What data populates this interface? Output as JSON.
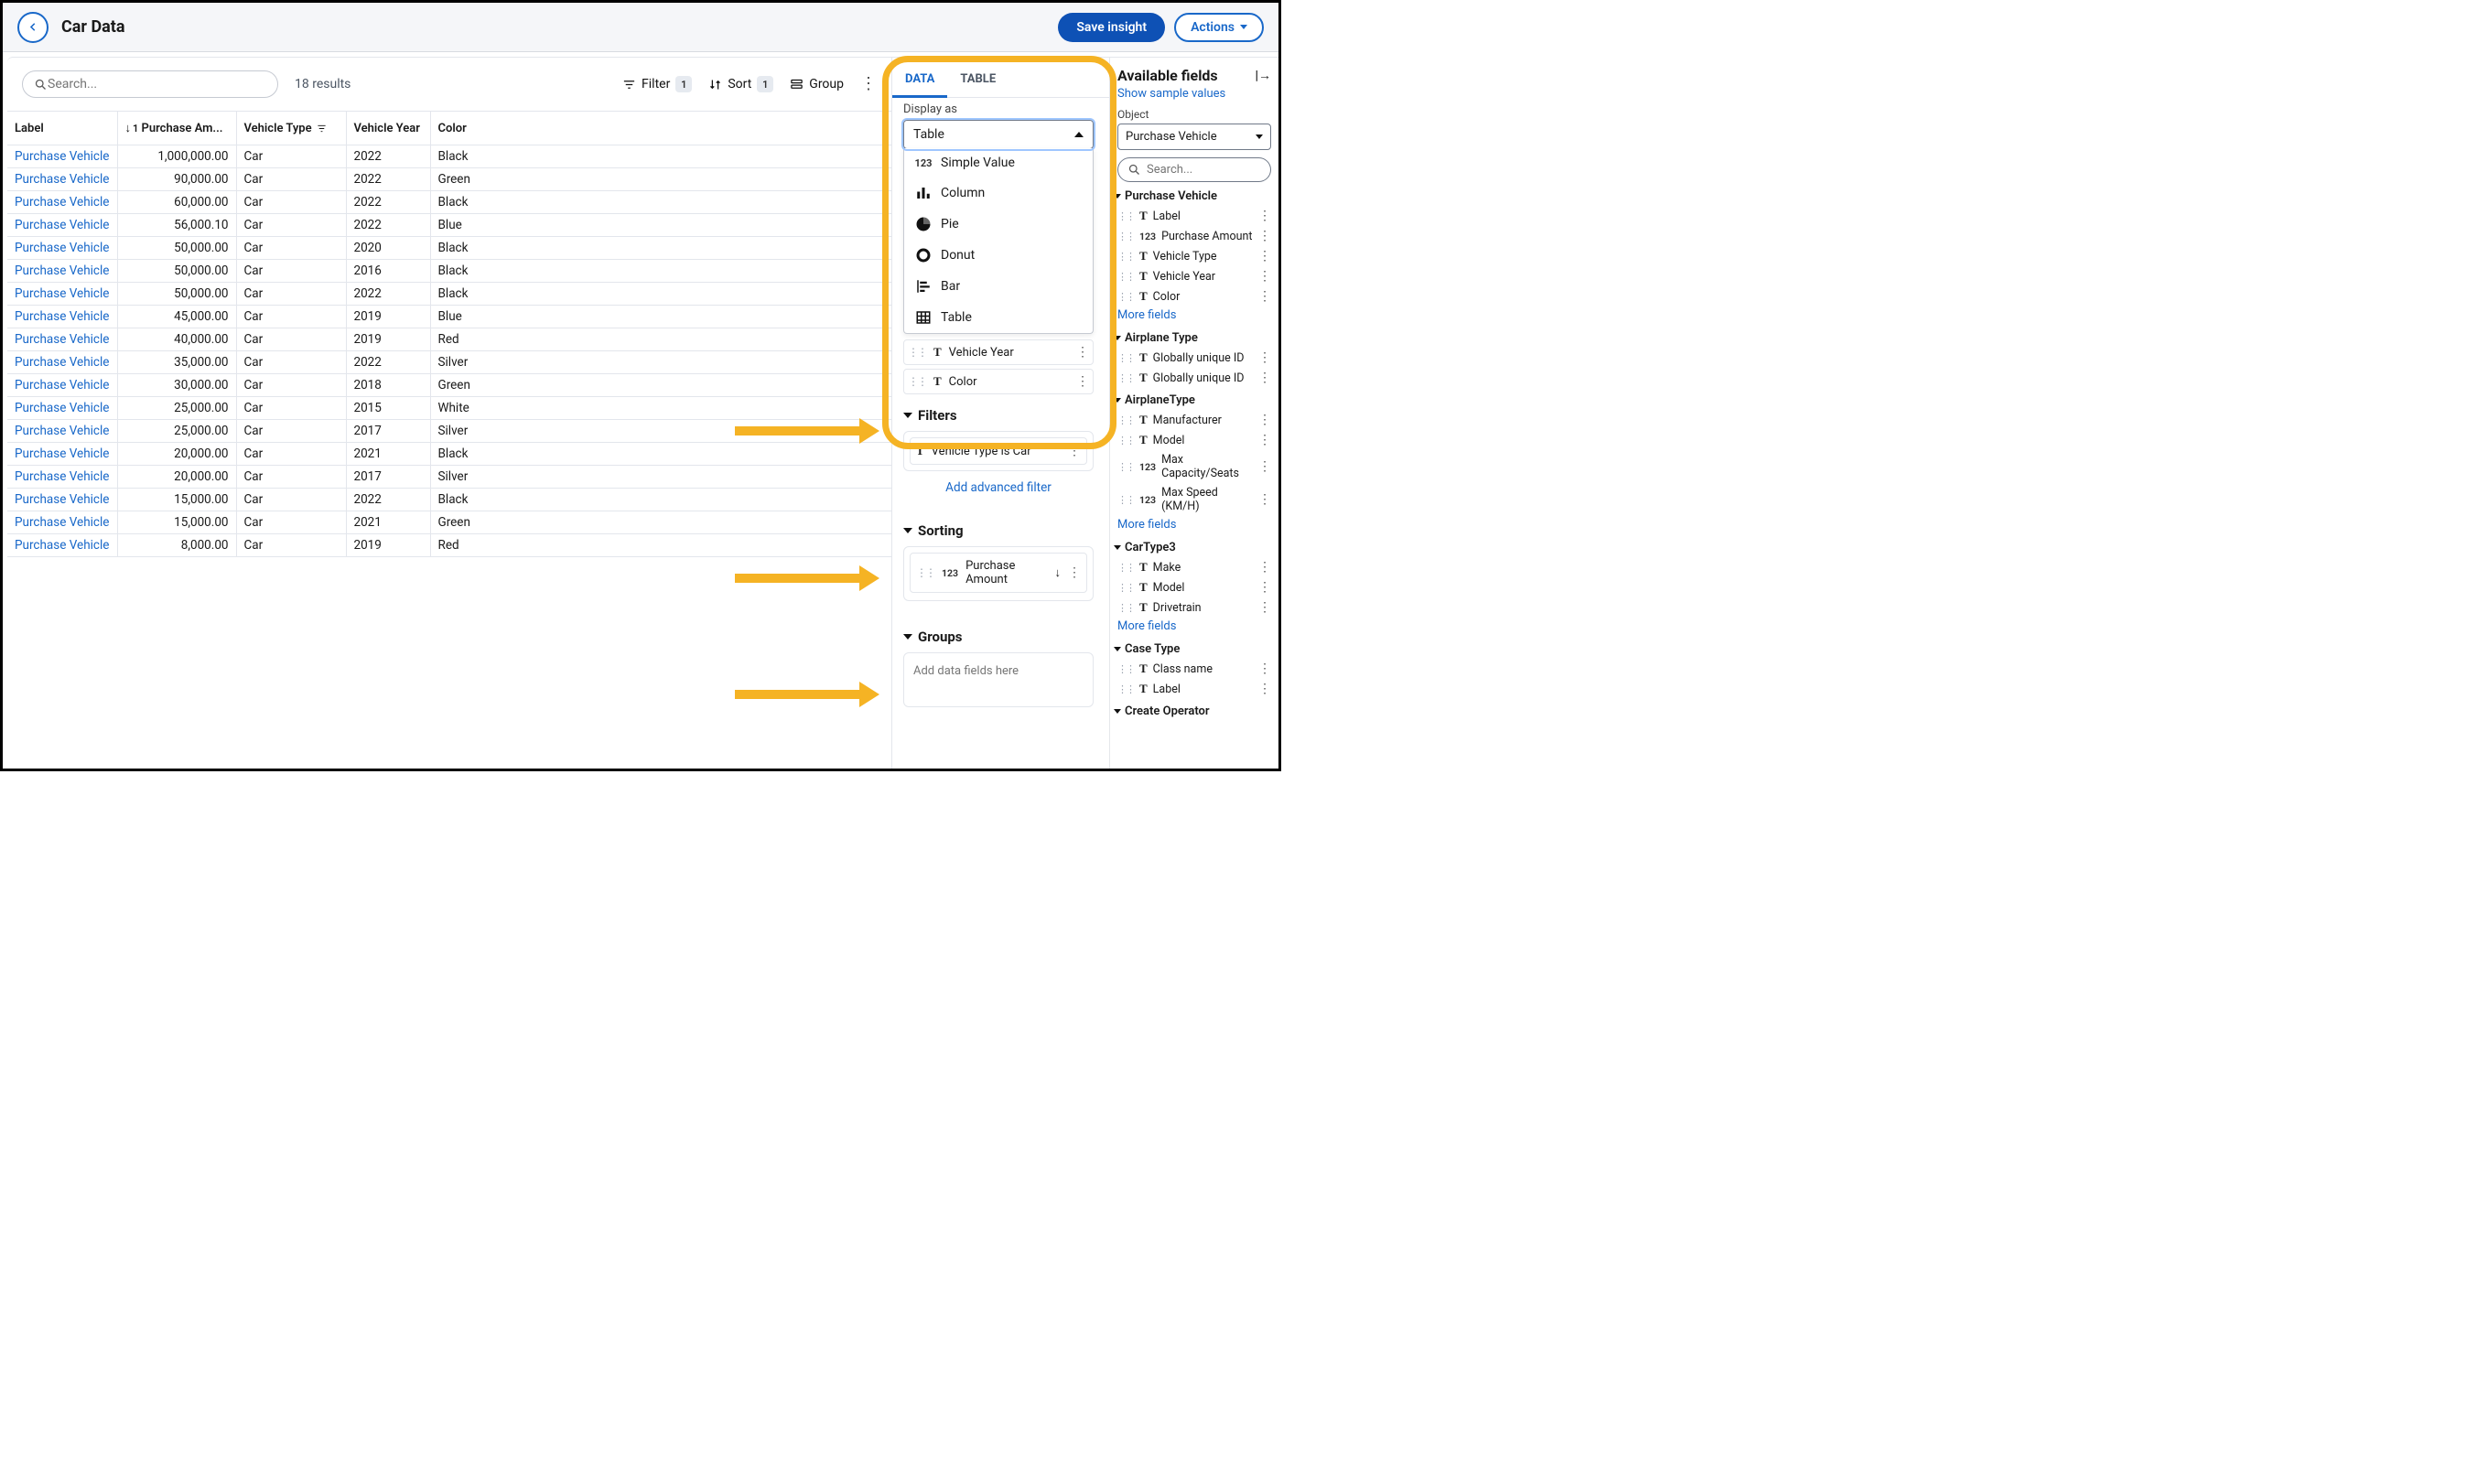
{
  "header": {
    "title": "Car Data",
    "save_label": "Save insight",
    "actions_label": "Actions"
  },
  "toolbar": {
    "search_placeholder": "Search...",
    "results": "18 results",
    "filter_label": "Filter",
    "filter_count": "1",
    "sort_label": "Sort",
    "sort_count": "1",
    "group_label": "Group"
  },
  "columns": {
    "label": "Label",
    "amount": "Purchase Am...",
    "vtype": "Vehicle Type",
    "vyear": "Vehicle Year",
    "color": "Color"
  },
  "rows": [
    {
      "label": "Purchase Vehicle",
      "amount": "1,000,000.00",
      "vtype": "Car",
      "vyear": "2022",
      "color": "Black"
    },
    {
      "label": "Purchase Vehicle",
      "amount": "90,000.00",
      "vtype": "Car",
      "vyear": "2022",
      "color": "Green"
    },
    {
      "label": "Purchase Vehicle",
      "amount": "60,000.00",
      "vtype": "Car",
      "vyear": "2022",
      "color": "Black"
    },
    {
      "label": "Purchase Vehicle",
      "amount": "56,000.10",
      "vtype": "Car",
      "vyear": "2022",
      "color": "Blue"
    },
    {
      "label": "Purchase Vehicle",
      "amount": "50,000.00",
      "vtype": "Car",
      "vyear": "2020",
      "color": "Black"
    },
    {
      "label": "Purchase Vehicle",
      "amount": "50,000.00",
      "vtype": "Car",
      "vyear": "2016",
      "color": "Black"
    },
    {
      "label": "Purchase Vehicle",
      "amount": "50,000.00",
      "vtype": "Car",
      "vyear": "2022",
      "color": "Black"
    },
    {
      "label": "Purchase Vehicle",
      "amount": "45,000.00",
      "vtype": "Car",
      "vyear": "2019",
      "color": "Blue"
    },
    {
      "label": "Purchase Vehicle",
      "amount": "40,000.00",
      "vtype": "Car",
      "vyear": "2019",
      "color": "Red"
    },
    {
      "label": "Purchase Vehicle",
      "amount": "35,000.00",
      "vtype": "Car",
      "vyear": "2022",
      "color": "Silver"
    },
    {
      "label": "Purchase Vehicle",
      "amount": "30,000.00",
      "vtype": "Car",
      "vyear": "2018",
      "color": "Green"
    },
    {
      "label": "Purchase Vehicle",
      "amount": "25,000.00",
      "vtype": "Car",
      "vyear": "2015",
      "color": "White"
    },
    {
      "label": "Purchase Vehicle",
      "amount": "25,000.00",
      "vtype": "Car",
      "vyear": "2017",
      "color": "Silver"
    },
    {
      "label": "Purchase Vehicle",
      "amount": "20,000.00",
      "vtype": "Car",
      "vyear": "2021",
      "color": "Black"
    },
    {
      "label": "Purchase Vehicle",
      "amount": "20,000.00",
      "vtype": "Car",
      "vyear": "2017",
      "color": "Silver"
    },
    {
      "label": "Purchase Vehicle",
      "amount": "15,000.00",
      "vtype": "Car",
      "vyear": "2022",
      "color": "Black"
    },
    {
      "label": "Purchase Vehicle",
      "amount": "15,000.00",
      "vtype": "Car",
      "vyear": "2021",
      "color": "Green"
    },
    {
      "label": "Purchase Vehicle",
      "amount": "8,000.00",
      "vtype": "Car",
      "vyear": "2019",
      "color": "Red"
    }
  ],
  "config": {
    "tab_data": "DATA",
    "tab_table": "TABLE",
    "display_as_label": "Display as",
    "display_selected": "Table",
    "display_options": [
      {
        "key": "simple",
        "label": "Simple Value"
      },
      {
        "key": "column",
        "label": "Column"
      },
      {
        "key": "pie",
        "label": "Pie"
      },
      {
        "key": "donut",
        "label": "Donut"
      },
      {
        "key": "bar",
        "label": "Bar"
      },
      {
        "key": "table",
        "label": "Table"
      }
    ],
    "columns_fields": [
      {
        "type": "T",
        "name": "Vehicle Year"
      },
      {
        "type": "T",
        "name": "Color"
      }
    ],
    "filters_title": "Filters",
    "filter_items": [
      {
        "type": "T",
        "text": "Vehicle Type is Car"
      }
    ],
    "advanced_filter": "Add advanced filter",
    "sorting_title": "Sorting",
    "sorting_items": [
      {
        "type": "123",
        "text": "Purchase Amount",
        "dir": "desc"
      }
    ],
    "groups_title": "Groups",
    "groups_hint": "Add data fields here"
  },
  "avail": {
    "title": "Available fields",
    "sample_link": "Show sample values",
    "object_label": "Object",
    "object_value": "Purchase Vehicle",
    "search_placeholder": "Search...",
    "more": "More fields",
    "groups": [
      {
        "name": "Purchase Vehicle",
        "fields": [
          {
            "t": "T",
            "name": "Label"
          },
          {
            "t": "123",
            "name": "Purchase Amount"
          },
          {
            "t": "T",
            "name": "Vehicle Type"
          },
          {
            "t": "T",
            "name": "Vehicle Year"
          },
          {
            "t": "T",
            "name": "Color"
          }
        ],
        "more": true
      },
      {
        "name": "Airplane Type",
        "fields": [
          {
            "t": "T",
            "name": "Globally unique ID"
          },
          {
            "t": "T",
            "name": "Globally unique ID"
          }
        ]
      },
      {
        "name": "AirplaneType",
        "fields": [
          {
            "t": "T",
            "name": "Manufacturer"
          },
          {
            "t": "T",
            "name": "Model"
          },
          {
            "t": "123",
            "name": "Max Capacity/Seats"
          },
          {
            "t": "123",
            "name": "Max Speed (KM/H)"
          }
        ],
        "more": true
      },
      {
        "name": "CarType3",
        "fields": [
          {
            "t": "T",
            "name": "Make"
          },
          {
            "t": "T",
            "name": "Model"
          },
          {
            "t": "T",
            "name": "Drivetrain"
          }
        ],
        "more": true
      },
      {
        "name": "Case Type",
        "fields": [
          {
            "t": "T",
            "name": "Class name"
          },
          {
            "t": "T",
            "name": "Label"
          }
        ]
      },
      {
        "name": "Create Operator",
        "fields": []
      }
    ]
  }
}
